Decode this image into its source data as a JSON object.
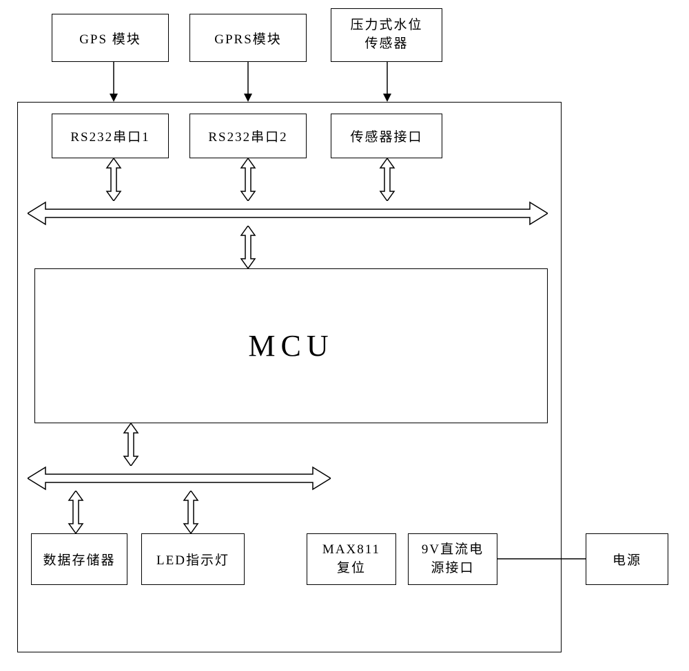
{
  "diagram": {
    "top_blocks": {
      "gps": "GPS 模块",
      "gprs": "GPRS模块",
      "sensor_line1": "压力式水位",
      "sensor_line2": "传感器"
    },
    "interface_blocks": {
      "rs232_1": "RS232串口1",
      "rs232_2": "RS232串口2",
      "sensor_if": "传感器接口"
    },
    "mcu": "MCU",
    "bottom_blocks": {
      "storage": "数据存储器",
      "led": "LED指示灯",
      "max811_line1": "MAX811",
      "max811_line2": "复位",
      "power_if_line1": "9V直流电",
      "power_if_line2": "源接口",
      "power": "电源"
    }
  }
}
